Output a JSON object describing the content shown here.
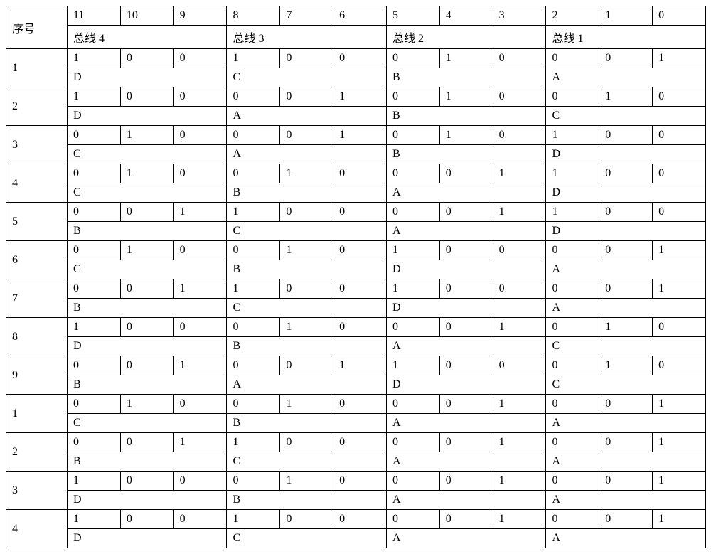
{
  "header": {
    "seq_label": "序号",
    "bit_labels": [
      "11",
      "10",
      "9",
      "8",
      "7",
      "6",
      "5",
      "4",
      "3",
      "2",
      "1",
      "0"
    ],
    "bus_labels": [
      "总线 4",
      "总线 3",
      "总线 2",
      "总线 1"
    ]
  },
  "rows": [
    {
      "seq": "1",
      "bits": [
        "1",
        "0",
        "0",
        "1",
        "0",
        "0",
        "0",
        "1",
        "0",
        "0",
        "0",
        "1"
      ],
      "letters": [
        "D",
        "C",
        "B",
        "A"
      ]
    },
    {
      "seq": "2",
      "bits": [
        "1",
        "0",
        "0",
        "0",
        "0",
        "1",
        "0",
        "1",
        "0",
        "0",
        "1",
        "0"
      ],
      "letters": [
        "D",
        "A",
        "B",
        "C"
      ]
    },
    {
      "seq": "3",
      "bits": [
        "0",
        "1",
        "0",
        "0",
        "0",
        "1",
        "0",
        "1",
        "0",
        "1",
        "0",
        "0"
      ],
      "letters": [
        "C",
        "A",
        "B",
        "D"
      ]
    },
    {
      "seq": "4",
      "bits": [
        "0",
        "1",
        "0",
        "0",
        "1",
        "0",
        "0",
        "0",
        "1",
        "1",
        "0",
        "0"
      ],
      "letters": [
        "C",
        "B",
        "A",
        "D"
      ]
    },
    {
      "seq": "5",
      "bits": [
        "0",
        "0",
        "1",
        "1",
        "0",
        "0",
        "0",
        "0",
        "1",
        "1",
        "0",
        "0"
      ],
      "letters": [
        "B",
        "C",
        "A",
        "D"
      ]
    },
    {
      "seq": "6",
      "bits": [
        "0",
        "1",
        "0",
        "0",
        "1",
        "0",
        "1",
        "0",
        "0",
        "0",
        "0",
        "1"
      ],
      "letters": [
        "C",
        "B",
        "D",
        "A"
      ]
    },
    {
      "seq": "7",
      "bits": [
        "0",
        "0",
        "1",
        "1",
        "0",
        "0",
        "1",
        "0",
        "0",
        "0",
        "0",
        "1"
      ],
      "letters": [
        "B",
        "C",
        "D",
        "A"
      ]
    },
    {
      "seq": "8",
      "bits": [
        "1",
        "0",
        "0",
        "0",
        "1",
        "0",
        "0",
        "0",
        "1",
        "0",
        "1",
        "0"
      ],
      "letters": [
        "D",
        "B",
        "A",
        "C"
      ]
    },
    {
      "seq": "9",
      "bits": [
        "0",
        "0",
        "1",
        "0",
        "0",
        "1",
        "1",
        "0",
        "0",
        "0",
        "1",
        "0"
      ],
      "letters": [
        "B",
        "A",
        "D",
        "C"
      ]
    },
    {
      "seq": "1",
      "bits": [
        "0",
        "1",
        "0",
        "0",
        "1",
        "0",
        "0",
        "0",
        "1",
        "0",
        "0",
        "1"
      ],
      "letters": [
        "C",
        "B",
        "A",
        "A"
      ]
    },
    {
      "seq": "2",
      "bits": [
        "0",
        "0",
        "1",
        "1",
        "0",
        "0",
        "0",
        "0",
        "1",
        "0",
        "0",
        "1"
      ],
      "letters": [
        "B",
        "C",
        "A",
        "A"
      ]
    },
    {
      "seq": "3",
      "bits": [
        "1",
        "0",
        "0",
        "0",
        "1",
        "0",
        "0",
        "0",
        "1",
        "0",
        "0",
        "1"
      ],
      "letters": [
        "D",
        "B",
        "A",
        "A"
      ]
    },
    {
      "seq": "4",
      "bits": [
        "1",
        "0",
        "0",
        "1",
        "0",
        "0",
        "0",
        "0",
        "1",
        "0",
        "0",
        "1"
      ],
      "letters": [
        "D",
        "C",
        "A",
        "A"
      ]
    }
  ]
}
